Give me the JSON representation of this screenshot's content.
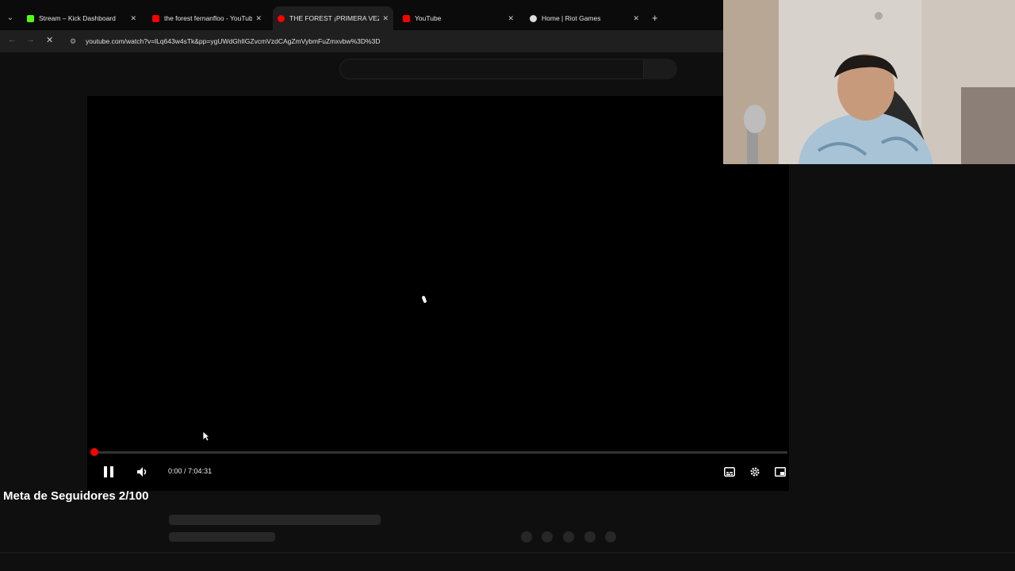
{
  "tabs": [
    {
      "label": "Stream – Kick Dashboard",
      "favicon_color": "#53fc18",
      "active": false
    },
    {
      "label": "the forest fernanfloo - YouTube",
      "favicon_color": "#ff0000",
      "active": false
    },
    {
      "label": "THE FOREST ¡PRIMERA VEZ",
      "favicon_color": "#ff0000",
      "active": true
    },
    {
      "label": "YouTube",
      "favicon_color": "#ff0000",
      "active": false
    },
    {
      "label": "Home | Riot Games",
      "favicon_color": "#dddddd",
      "active": false
    }
  ],
  "address_bar": {
    "url": "youtube.com/watch?v=lLq643w4sTk&pp=ygUWdGhlIGZvcmVzdCAgZmVybmFuZmxvbw%3D%3D"
  },
  "player": {
    "current_time": "0:00",
    "separator": " / ",
    "duration": "7:04:31",
    "progress_fraction": 0.0
  },
  "overlay": {
    "goal_text": "Meta de Seguidores 2/100"
  },
  "colors": {
    "accent_red": "#ff0000",
    "kick_green": "#53fc18",
    "background": "#0f0f0f"
  }
}
